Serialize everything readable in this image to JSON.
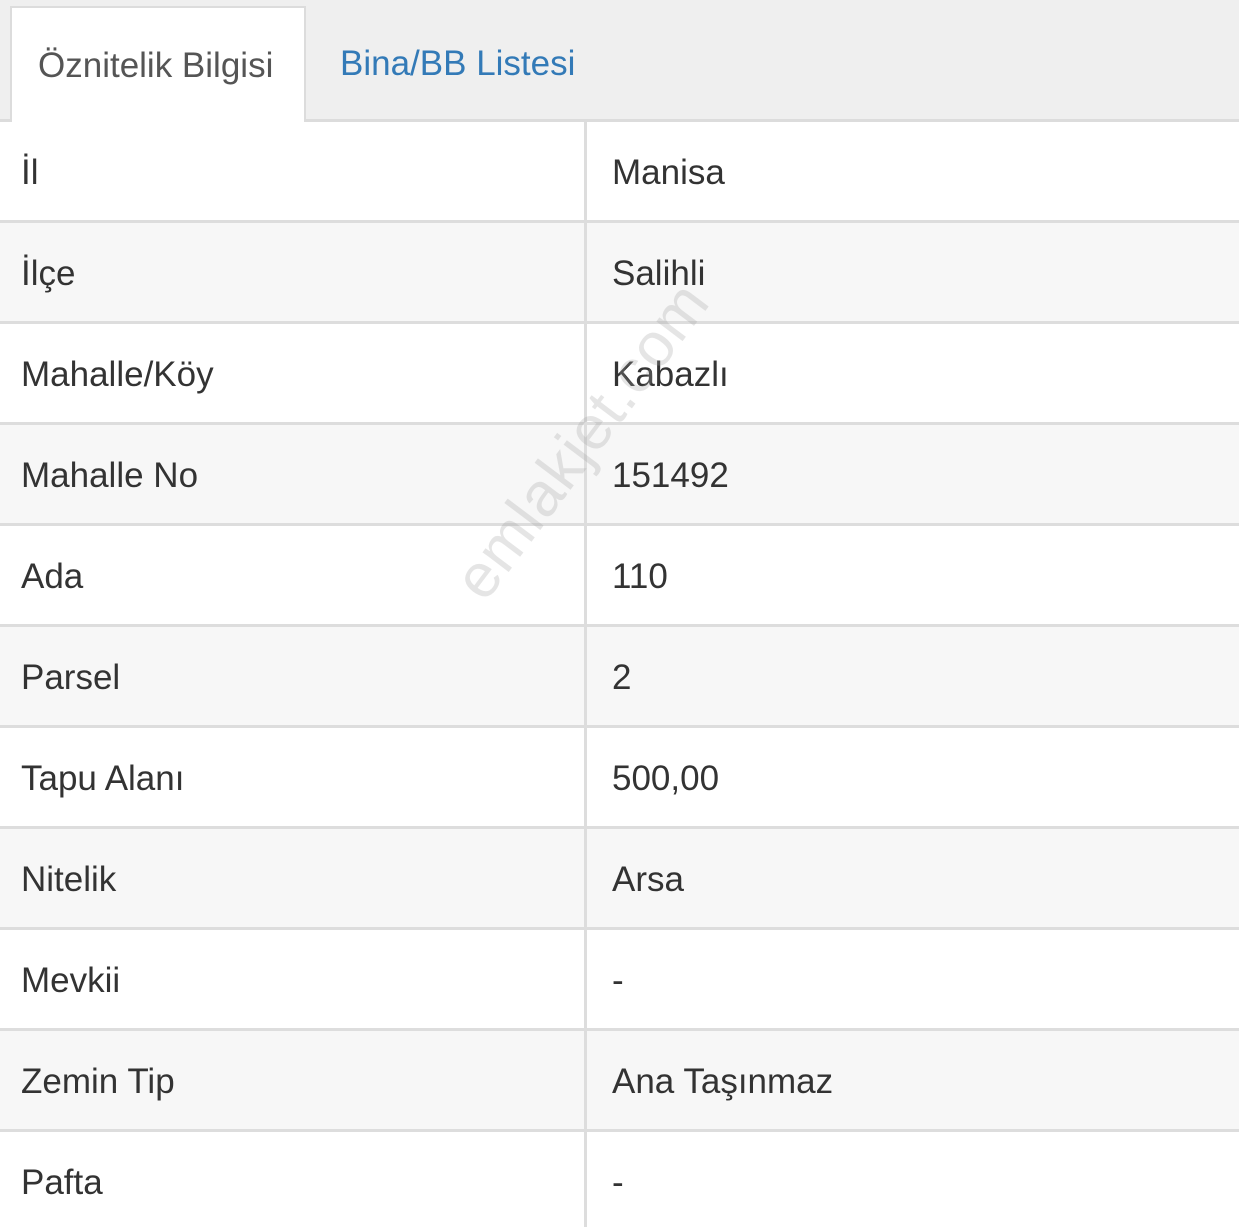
{
  "tabs": {
    "active_label": "Öznitelik Bilgisi",
    "inactive_label": "Bina/BB Listesi"
  },
  "rows": [
    {
      "label": "İl",
      "value": "Manisa"
    },
    {
      "label": "İlçe",
      "value": "Salihli"
    },
    {
      "label": "Mahalle/Köy",
      "value": "Kabazlı"
    },
    {
      "label": "Mahalle No",
      "value": "151492"
    },
    {
      "label": "Ada",
      "value": "110"
    },
    {
      "label": "Parsel",
      "value": "2"
    },
    {
      "label": "Tapu Alanı",
      "value": "500,00"
    },
    {
      "label": "Nitelik",
      "value": "Arsa"
    },
    {
      "label": "Mevkii",
      "value": "-"
    },
    {
      "label": "Zemin Tip",
      "value": "Ana Taşınmaz"
    },
    {
      "label": "Pafta",
      "value": "-"
    }
  ],
  "watermark": "emlakjet.com",
  "colors": {
    "link": "#337ab7",
    "tabbar_bg": "#efefef",
    "row_alt_bg": "#f7f7f7",
    "border": "#dddddd"
  }
}
